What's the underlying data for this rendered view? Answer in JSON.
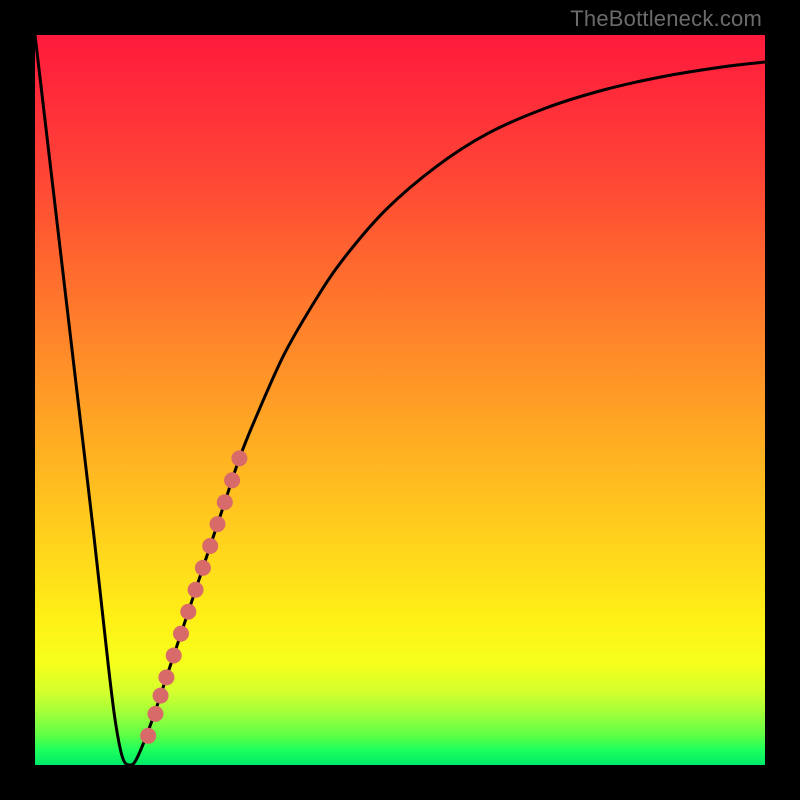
{
  "attribution": "TheBottleneck.com",
  "colors": {
    "curve_stroke": "#000000",
    "marker_fill": "#d86a6a",
    "gradient_top": "#ff1a3c",
    "gradient_bottom": "#00e968",
    "frame_bg": "#000000"
  },
  "chart_data": {
    "type": "line",
    "title": "",
    "xlabel": "",
    "ylabel": "",
    "xlim": [
      0,
      100
    ],
    "ylim": [
      0,
      100
    ],
    "x": [
      0,
      2,
      4,
      6,
      8,
      10,
      11,
      12,
      13,
      14,
      16,
      18,
      20,
      22,
      24,
      26,
      28,
      30,
      34,
      38,
      42,
      48,
      55,
      62,
      70,
      78,
      86,
      94,
      100
    ],
    "y": [
      100,
      83,
      66,
      49,
      32,
      14,
      6,
      1,
      0,
      1,
      6,
      12,
      18,
      24,
      30,
      36,
      42,
      47,
      56,
      63,
      69,
      76,
      82,
      86.5,
      90,
      92.5,
      94.3,
      95.6,
      96.3
    ],
    "series": [
      {
        "name": "bottleneck-curve",
        "description": "V-shaped curve dipping to 0 near x≈13 then asymptotically rising"
      }
    ],
    "markers": {
      "description": "salmon circular markers along rising branch near the minimum",
      "points": [
        {
          "x": 15.5,
          "y": 4
        },
        {
          "x": 16.5,
          "y": 7
        },
        {
          "x": 17.2,
          "y": 9.5
        },
        {
          "x": 18.0,
          "y": 12
        },
        {
          "x": 19.0,
          "y": 15
        },
        {
          "x": 20.0,
          "y": 18
        },
        {
          "x": 21.0,
          "y": 21
        },
        {
          "x": 22.0,
          "y": 24
        },
        {
          "x": 23.0,
          "y": 27
        },
        {
          "x": 24.0,
          "y": 30
        },
        {
          "x": 25.0,
          "y": 33
        },
        {
          "x": 26.0,
          "y": 36
        },
        {
          "x": 27.0,
          "y": 39
        },
        {
          "x": 28.0,
          "y": 42
        }
      ],
      "radius_px": 8
    }
  }
}
